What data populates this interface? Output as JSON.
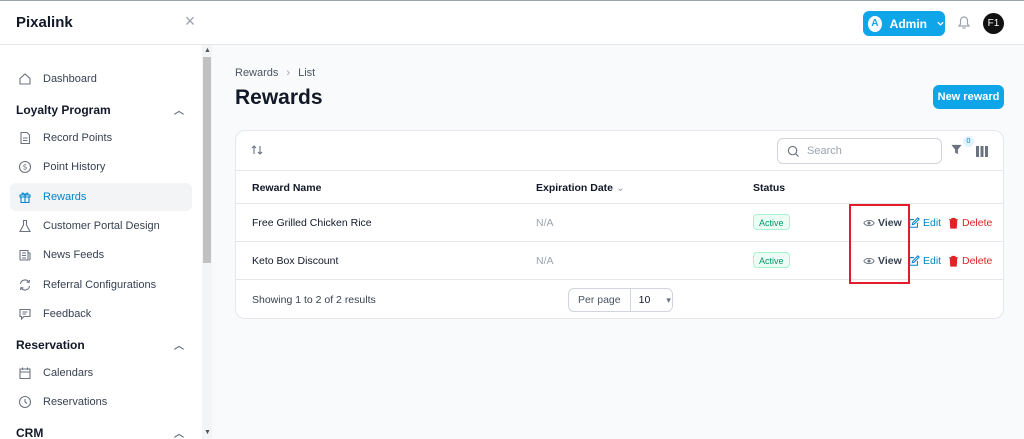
{
  "app": {
    "brand": "Pixalink"
  },
  "header": {
    "admin_label": "Admin",
    "admin_initial": "A",
    "user_initials": "F1"
  },
  "sidebar": {
    "dashboard": "Dashboard",
    "group_loyalty": "Loyalty Program",
    "record_points": "Record Points",
    "point_history": "Point History",
    "rewards": "Rewards",
    "customer_portal": "Customer Portal Design",
    "news_feeds": "News Feeds",
    "referral": "Referral Configurations",
    "feedback": "Feedback",
    "group_reservation": "Reservation",
    "calendars": "Calendars",
    "reservations": "Reservations",
    "group_crm": "CRM"
  },
  "page": {
    "breadcrumb_parent": "Rewards",
    "breadcrumb_current": "List",
    "title": "Rewards",
    "new_button": "New reward"
  },
  "table": {
    "search_placeholder": "Search",
    "filter_count": "0",
    "columns": {
      "name": "Reward Name",
      "expiration": "Expiration Date",
      "status": "Status"
    },
    "rows": [
      {
        "name": "Free Grilled Chicken Rice",
        "expiration": "N/A",
        "status": "Active"
      },
      {
        "name": "Keto Box Discount",
        "expiration": "N/A",
        "status": "Active"
      }
    ],
    "actions": {
      "view": "View",
      "edit": "Edit",
      "delete": "Delete"
    },
    "footer_text": "Showing 1 to 2 of 2 results",
    "per_page_label": "Per page",
    "per_page_value": "10"
  },
  "colors": {
    "accent": "#0ea5e9",
    "active_nav": "#0284c7",
    "danger": "#dc2626",
    "success": "#059669",
    "highlight": "#e11d2b"
  }
}
